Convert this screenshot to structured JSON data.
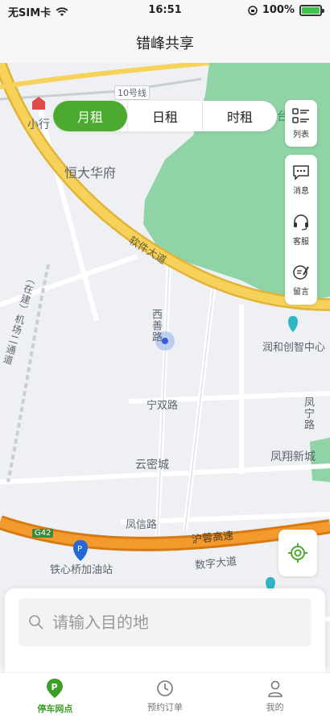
{
  "status_bar": {
    "carrier": "无SIM卡",
    "time": "16:51",
    "battery": "100%",
    "battery_level": 1.0
  },
  "nav": {
    "title": "错峰共享"
  },
  "rent_tabs": [
    {
      "label": "月租",
      "active": true
    },
    {
      "label": "日租",
      "active": false
    },
    {
      "label": "时租",
      "active": false
    }
  ],
  "side_buttons": {
    "list": {
      "label": "列表",
      "icon": "list-icon"
    },
    "message": {
      "label": "消息",
      "icon": "message-icon"
    },
    "service": {
      "label": "客服",
      "icon": "headset-icon"
    },
    "feedback": {
      "label": "留言",
      "icon": "feedback-icon"
    }
  },
  "map": {
    "labels": {
      "xiaoxing": "小行",
      "line10": "10号线",
      "hengda": "恒大华府",
      "ruanjian": "软件大道",
      "jichang": "（在建）机场二通道",
      "xishan": "西善路",
      "runhe": "润和创智中心",
      "ningshuang": "宁双路",
      "fengning": "凤宁路",
      "yunmi": "云密城",
      "fengxiang": "凤翔新城",
      "fengxin": "凤信路",
      "hurong": "沪蓉高速",
      "g42": "G42",
      "tiexinqiao": "铁心桥加油站",
      "shuzi": "数字大道",
      "tai": "台"
    },
    "colors": {
      "background": "#eef0f3",
      "park": "#8fd3a6",
      "ring_road": "#f4c842",
      "expressway": "#f08c1e",
      "road": "#ffffff"
    }
  },
  "search": {
    "placeholder": "请输入目的地",
    "value": ""
  },
  "tab_bar": [
    {
      "label": "停车网点",
      "icon": "parking-icon",
      "active": true
    },
    {
      "label": "预约订单",
      "icon": "clock-icon",
      "active": false
    },
    {
      "label": "我的",
      "icon": "person-icon",
      "active": false
    }
  ]
}
